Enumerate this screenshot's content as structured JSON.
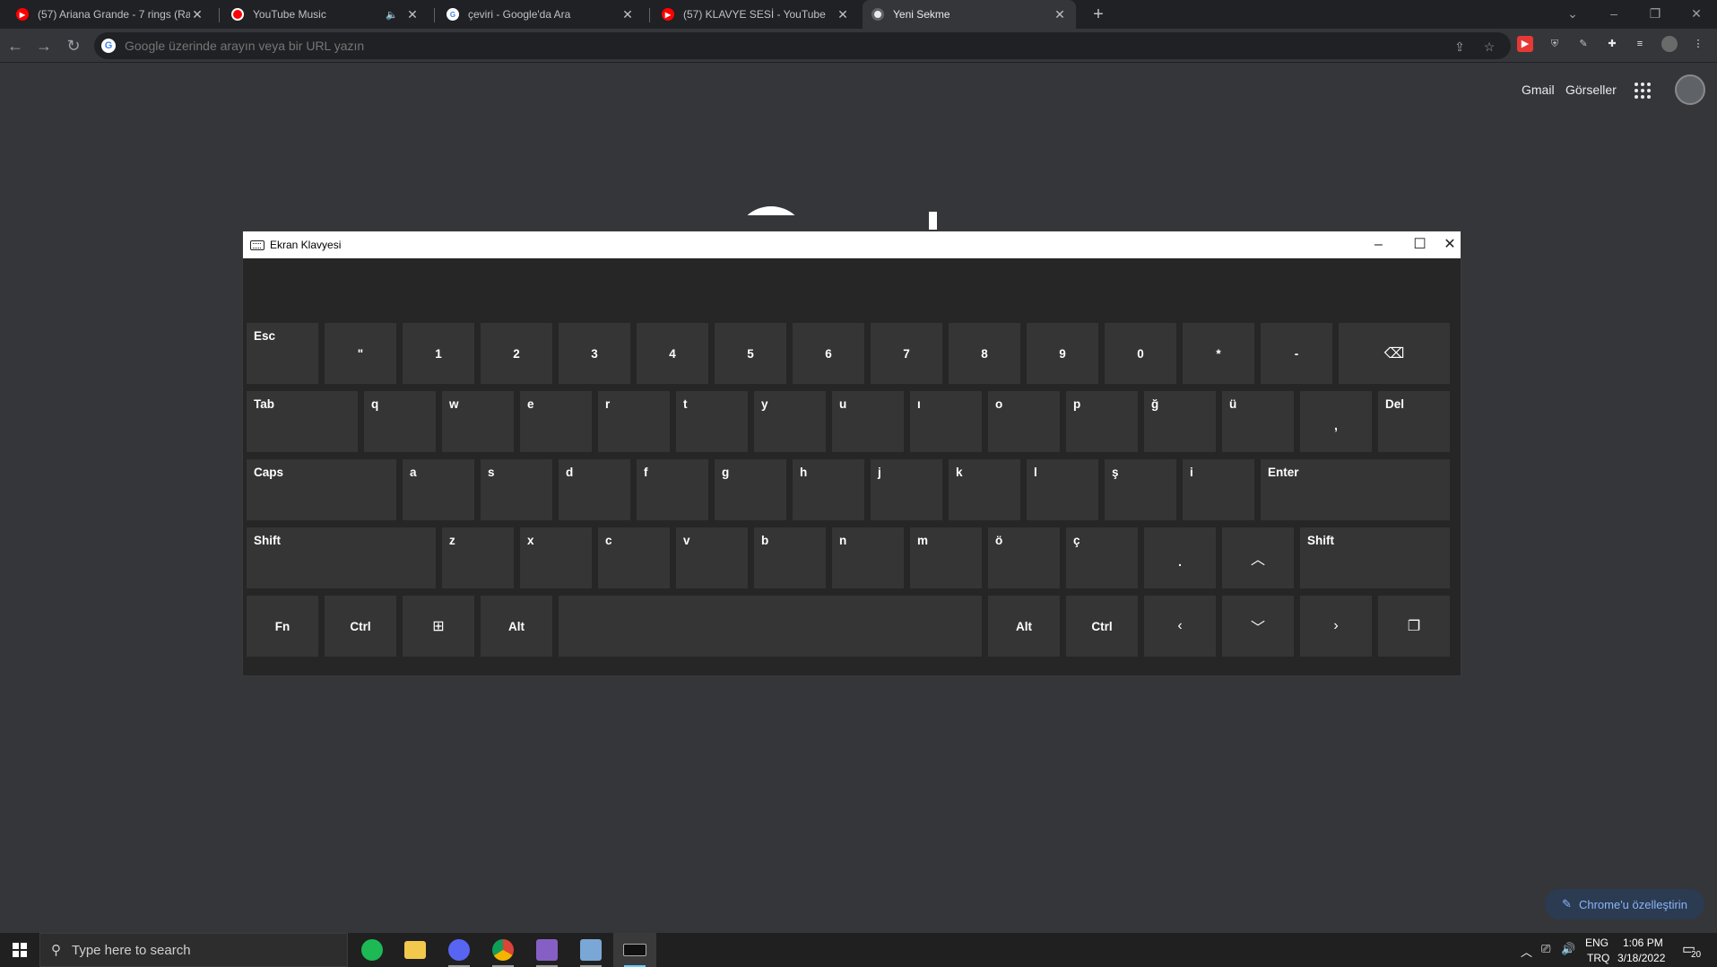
{
  "browser": {
    "tabs": [
      {
        "title": "(57) Ariana Grande - 7 rings (Ra",
        "favicon": "youtube-icon",
        "active": false
      },
      {
        "title": "YouTube Music",
        "favicon": "youtube-music-icon",
        "active": false
      },
      {
        "title": "çeviri - Google'da Ara",
        "favicon": "google-icon",
        "active": false
      },
      {
        "title": "(57) KLAVYE SESİ - YouTube",
        "favicon": "youtube-icon",
        "active": false
      },
      {
        "title": "Yeni Sekme",
        "favicon": "chrome-icon",
        "active": true
      }
    ],
    "new_tab": "+",
    "omnibox_placeholder": "Google üzerinde arayın veya bir URL yazın"
  },
  "ntp": {
    "gmail": "Gmail",
    "images": "Görseller",
    "customize": "Chrome'u özelleştirin"
  },
  "osk": {
    "title": "Ekran Klavyesi",
    "rows": [
      [
        "Esc",
        "\"",
        "1",
        "2",
        "3",
        "4",
        "5",
        "6",
        "7",
        "8",
        "9",
        "0",
        "*",
        "-",
        "backspace"
      ],
      [
        "Tab",
        "q",
        "w",
        "e",
        "r",
        "t",
        "y",
        "u",
        "ı",
        "o",
        "p",
        "ğ",
        "ü",
        ",",
        "Del"
      ],
      [
        "Caps",
        "a",
        "s",
        "d",
        "f",
        "g",
        "h",
        "j",
        "k",
        "l",
        "ş",
        "i",
        "Enter"
      ],
      [
        "Shift",
        "z",
        "x",
        "c",
        "v",
        "b",
        "n",
        "m",
        "ö",
        "ç",
        ".",
        "up-arrow",
        "Shift"
      ],
      [
        "Fn",
        "Ctrl",
        "windows",
        "Alt",
        "space",
        "Alt",
        "Ctrl",
        "left-arrow",
        "down-arrow",
        "right-arrow",
        "options"
      ]
    ]
  },
  "taskbar": {
    "search_placeholder": "Type here to search",
    "apps": [
      "spotify-icon",
      "file-explorer-icon",
      "discord-icon",
      "chrome-icon",
      "visual-studio-icon",
      "app-icon",
      "on-screen-keyboard-icon"
    ],
    "language": "ENG",
    "layout": "TRQ",
    "time": "1:06 PM",
    "date": "3/18/2022",
    "notifications": "20"
  }
}
